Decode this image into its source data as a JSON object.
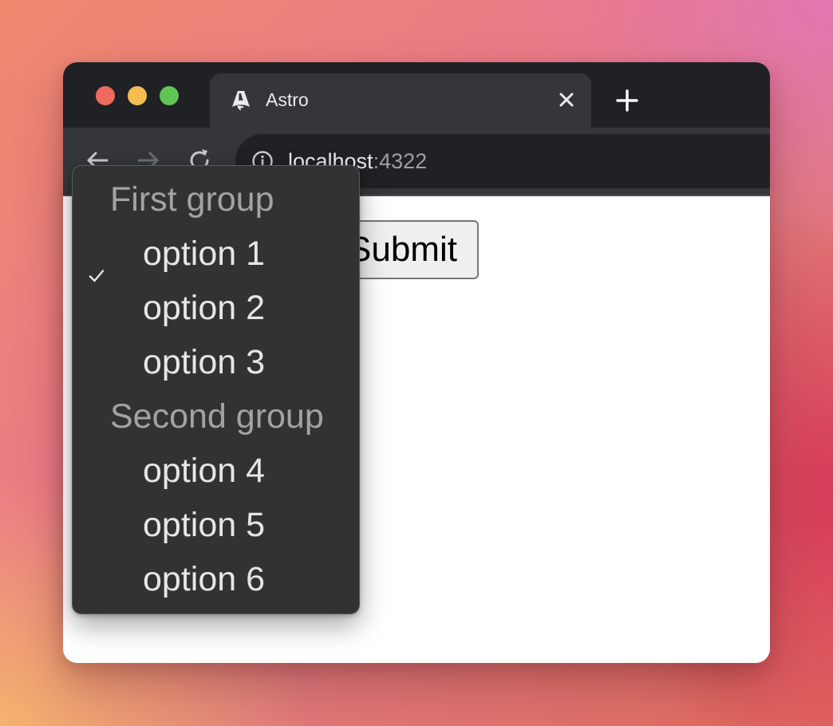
{
  "window": {
    "tab": {
      "title": "Astro",
      "favicon": "astro-logo-icon",
      "close_icon": "close-icon"
    },
    "new_tab_icon": "plus-icon",
    "traffic_lights": [
      "#ee6a5e",
      "#f4bd4f",
      "#61c454"
    ]
  },
  "toolbar": {
    "back_icon": "arrow-left-icon",
    "forward_icon": "arrow-right-icon",
    "reload_icon": "reload-icon",
    "address": {
      "info_icon": "info-icon",
      "host": "localhost",
      "port": ":4322"
    }
  },
  "page": {
    "submit_label": "Submit"
  },
  "dropdown": {
    "selected": "option 1",
    "check_icon": "checkmark-icon",
    "groups": [
      {
        "label": "First group",
        "options": [
          "option 1",
          "option 2",
          "option 3"
        ]
      },
      {
        "label": "Second group",
        "options": [
          "option 4",
          "option 5",
          "option 6"
        ]
      }
    ]
  },
  "colors": {
    "titlebar": "#202124",
    "toolbar": "#35363a",
    "dropdown_bg": "#323232",
    "group_label": "#a3a3a3",
    "option_text": "#e6e6e6"
  }
}
